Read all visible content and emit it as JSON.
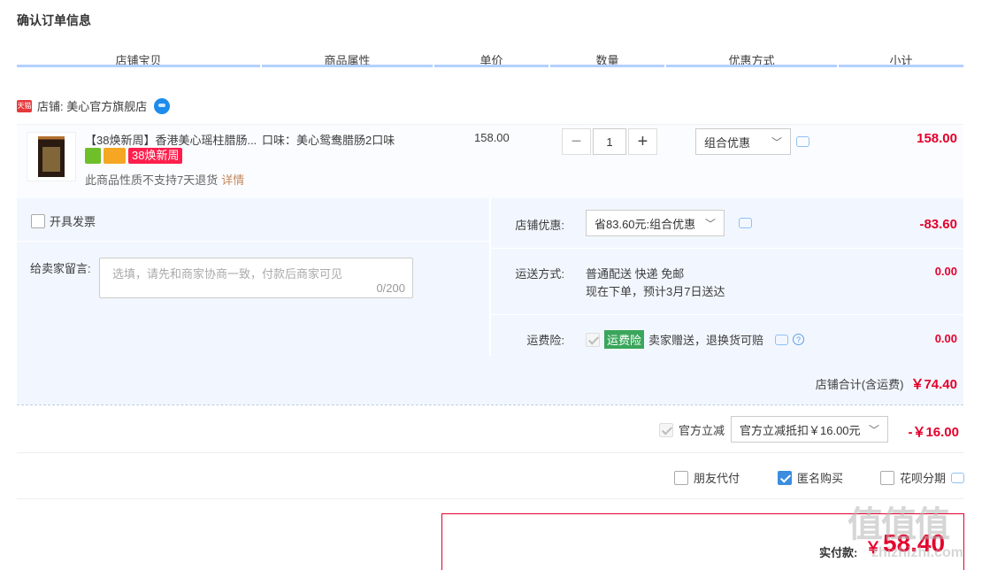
{
  "page_title": "确认订单信息",
  "columns": [
    "店铺宝贝",
    "商品属性",
    "单价",
    "数量",
    "优惠方式",
    "小计"
  ],
  "shop": {
    "badge": "天猫",
    "label": "店铺: 美心官方旗舰店"
  },
  "item": {
    "title": "【38焕新周】香港美心瑶柱腊肠...",
    "attribute": "口味：美心鸳鸯腊肠2口味",
    "promo_badge": "38焕新周",
    "note": "此商品性质不支持7天退货",
    "note_link": "详情",
    "price": "158.00",
    "quantity": "1",
    "discount_select": "组合优惠",
    "subtotal": "158.00"
  },
  "invoice_label": "开具发票",
  "message_label": "给卖家留言:",
  "message_placeholder": "选填，请先和商家协商一致，付款后商家可见",
  "message_count": "0/200",
  "shop_discount": {
    "label": "店铺优惠:",
    "select": "省83.60元:组合优惠",
    "amount": "-83.60"
  },
  "shipping": {
    "label": "运送方式:",
    "line1": "普通配送 快递 免邮",
    "line2": "现在下单，预计3月7日送达",
    "amount": "0.00"
  },
  "insurance": {
    "label": "运费险:",
    "tag": "运费险",
    "text": "卖家赠送，退换货可赔",
    "amount": "0.00"
  },
  "shop_total": {
    "label": "店铺合计(含运费)",
    "amount": "￥74.40"
  },
  "official_discount": {
    "label": "官方立减",
    "select": "官方立减抵扣￥16.00元",
    "amount": "-￥16.00"
  },
  "options": {
    "friend_pay": "朋友代付",
    "anonymous": "匿名购买",
    "huabei": "花呗分期"
  },
  "pay": {
    "label": "实付款:",
    "currency": "￥",
    "amount": "58.40"
  },
  "watermark": {
    "big": "值值值",
    "small": "zhizhizhi.com"
  },
  "colors": {
    "accent_red": "#e4002b",
    "header_line": "#b2d1ff",
    "panel_bg": "#f2f7ff"
  }
}
